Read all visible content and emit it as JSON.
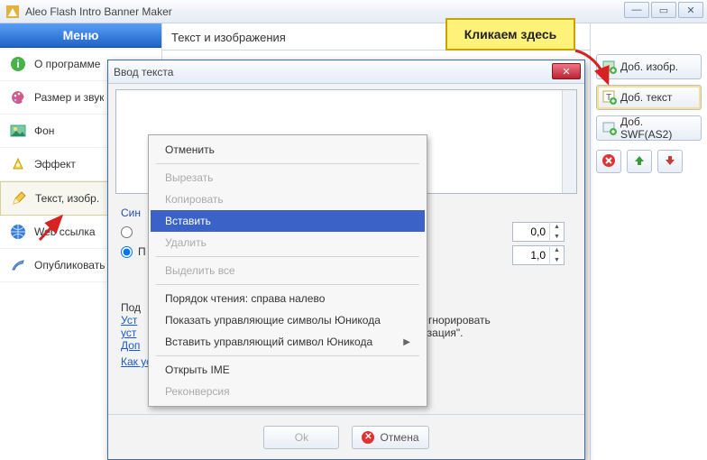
{
  "app": {
    "title": "Aleo Flash Intro Banner Maker"
  },
  "callout": {
    "text": "Кликаем здесь"
  },
  "sidebar": {
    "header": "Меню",
    "items": [
      {
        "label": "О программе",
        "icon": "info-icon"
      },
      {
        "label": "Размер и звук",
        "icon": "palette-icon"
      },
      {
        "label": "Фон",
        "icon": "background-icon"
      },
      {
        "label": "Эффект",
        "icon": "effect-icon"
      },
      {
        "label": "Текст, изобр.",
        "icon": "pencil-icon",
        "active": true
      },
      {
        "label": "Web ссылка",
        "icon": "globe-icon"
      },
      {
        "label": "Опубликовать",
        "icon": "publish-icon"
      }
    ]
  },
  "main": {
    "section_title": "Текст и изображения"
  },
  "right": {
    "buttons": [
      {
        "label": "Доб. изобр."
      },
      {
        "label": "Доб. текст",
        "highlight": true
      },
      {
        "label": "Доб. SWF(AS2)"
      }
    ]
  },
  "dialog": {
    "title": "Ввод текста",
    "radios": {
      "sync_label_prefix": "Син",
      "second_visible_char": "П"
    },
    "steppers": {
      "a": "0,0",
      "b": "1,0"
    },
    "hint": {
      "lead": "Под",
      "line1a": "Уст",
      "line1b": "я опция \"Игнорировать",
      "line2a": "уст",
      "line2b": "\"Синхронизация\".",
      "more": "Доп",
      "link": "Как установить параметры синхронизации?"
    },
    "ok": "Ok",
    "cancel": "Отмена"
  },
  "context_menu": {
    "items": [
      {
        "label": "Отменить",
        "state": "normal"
      },
      {
        "type": "sep"
      },
      {
        "label": "Вырезать",
        "state": "disabled"
      },
      {
        "label": "Копировать",
        "state": "disabled"
      },
      {
        "label": "Вставить",
        "state": "highlight"
      },
      {
        "label": "Удалить",
        "state": "disabled"
      },
      {
        "type": "sep"
      },
      {
        "label": "Выделить все",
        "state": "disabled"
      },
      {
        "type": "sep"
      },
      {
        "label": "Порядок чтения: справа налево",
        "state": "normal"
      },
      {
        "label": "Показать управляющие символы Юникода",
        "state": "normal"
      },
      {
        "label": "Вставить управляющий символ Юникода",
        "state": "normal",
        "submenu": true
      },
      {
        "type": "sep"
      },
      {
        "label": "Открыть IME",
        "state": "normal"
      },
      {
        "label": "Реконверсия",
        "state": "disabled"
      }
    ]
  }
}
